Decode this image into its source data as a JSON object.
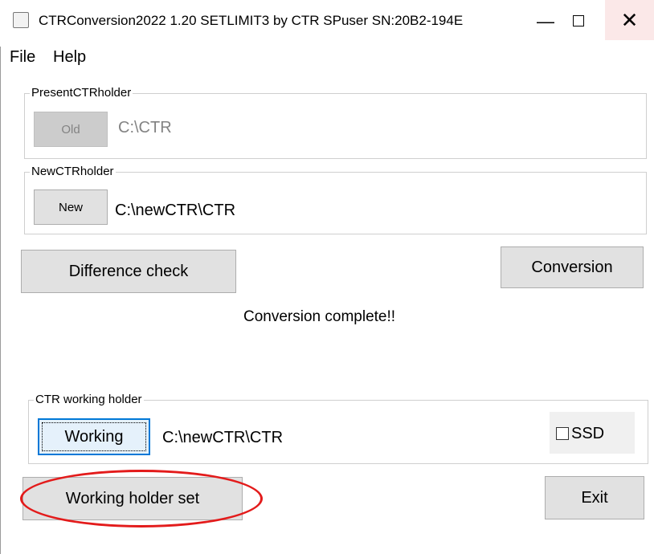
{
  "window": {
    "title": "CTRConversion2022 1.20 SETLIMIT3 by CTR SPuser   SN:20B2-194E",
    "icon": "app-icon",
    "controls": {
      "minimize": "—",
      "maximize": "□",
      "close": "✕"
    }
  },
  "menu": {
    "items": [
      "File",
      "Help"
    ]
  },
  "present_holder": {
    "legend": "PresentCTRholder",
    "button_label": "Old",
    "button_enabled": false,
    "path": "C:\\CTR"
  },
  "new_holder": {
    "legend": "NewCTRholder",
    "button_label": "New",
    "path": "C:\\newCTR\\CTR"
  },
  "actions": {
    "difference_check": "Difference check",
    "conversion": "Conversion"
  },
  "status_message": "Conversion complete!!",
  "working_holder": {
    "legend": "CTR working holder",
    "button_label": "Working",
    "path": "C:\\newCTR\\CTR",
    "ssd_label": "SSD",
    "ssd_checked": false
  },
  "footer": {
    "working_holder_set": "Working holder set",
    "exit": "Exit"
  },
  "colors": {
    "highlight": "#e31b1b",
    "focus": "#0078d7",
    "close_hover": "#fbe8e8"
  }
}
